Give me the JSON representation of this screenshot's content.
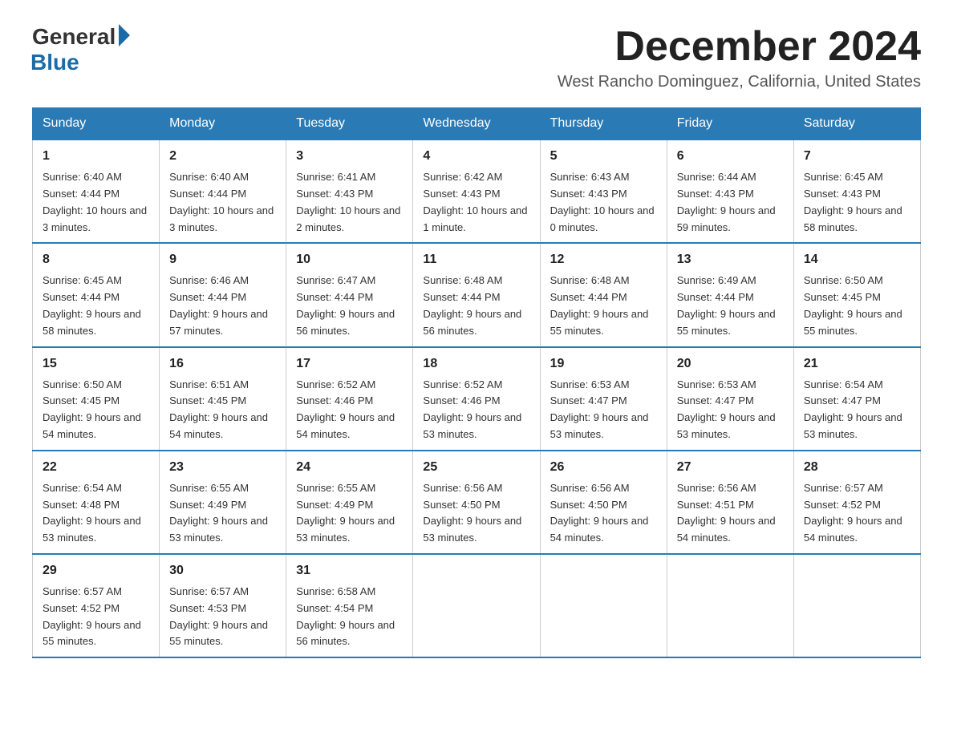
{
  "header": {
    "logo_general": "General",
    "logo_blue": "Blue",
    "month_title": "December 2024",
    "location": "West Rancho Dominguez, California, United States"
  },
  "weekdays": [
    "Sunday",
    "Monday",
    "Tuesday",
    "Wednesday",
    "Thursday",
    "Friday",
    "Saturday"
  ],
  "weeks": [
    [
      {
        "day": "1",
        "sunrise": "6:40 AM",
        "sunset": "4:44 PM",
        "daylight": "10 hours and 3 minutes."
      },
      {
        "day": "2",
        "sunrise": "6:40 AM",
        "sunset": "4:44 PM",
        "daylight": "10 hours and 3 minutes."
      },
      {
        "day": "3",
        "sunrise": "6:41 AM",
        "sunset": "4:43 PM",
        "daylight": "10 hours and 2 minutes."
      },
      {
        "day": "4",
        "sunrise": "6:42 AM",
        "sunset": "4:43 PM",
        "daylight": "10 hours and 1 minute."
      },
      {
        "day": "5",
        "sunrise": "6:43 AM",
        "sunset": "4:43 PM",
        "daylight": "10 hours and 0 minutes."
      },
      {
        "day": "6",
        "sunrise": "6:44 AM",
        "sunset": "4:43 PM",
        "daylight": "9 hours and 59 minutes."
      },
      {
        "day": "7",
        "sunrise": "6:45 AM",
        "sunset": "4:43 PM",
        "daylight": "9 hours and 58 minutes."
      }
    ],
    [
      {
        "day": "8",
        "sunrise": "6:45 AM",
        "sunset": "4:44 PM",
        "daylight": "9 hours and 58 minutes."
      },
      {
        "day": "9",
        "sunrise": "6:46 AM",
        "sunset": "4:44 PM",
        "daylight": "9 hours and 57 minutes."
      },
      {
        "day": "10",
        "sunrise": "6:47 AM",
        "sunset": "4:44 PM",
        "daylight": "9 hours and 56 minutes."
      },
      {
        "day": "11",
        "sunrise": "6:48 AM",
        "sunset": "4:44 PM",
        "daylight": "9 hours and 56 minutes."
      },
      {
        "day": "12",
        "sunrise": "6:48 AM",
        "sunset": "4:44 PM",
        "daylight": "9 hours and 55 minutes."
      },
      {
        "day": "13",
        "sunrise": "6:49 AM",
        "sunset": "4:44 PM",
        "daylight": "9 hours and 55 minutes."
      },
      {
        "day": "14",
        "sunrise": "6:50 AM",
        "sunset": "4:45 PM",
        "daylight": "9 hours and 55 minutes."
      }
    ],
    [
      {
        "day": "15",
        "sunrise": "6:50 AM",
        "sunset": "4:45 PM",
        "daylight": "9 hours and 54 minutes."
      },
      {
        "day": "16",
        "sunrise": "6:51 AM",
        "sunset": "4:45 PM",
        "daylight": "9 hours and 54 minutes."
      },
      {
        "day": "17",
        "sunrise": "6:52 AM",
        "sunset": "4:46 PM",
        "daylight": "9 hours and 54 minutes."
      },
      {
        "day": "18",
        "sunrise": "6:52 AM",
        "sunset": "4:46 PM",
        "daylight": "9 hours and 53 minutes."
      },
      {
        "day": "19",
        "sunrise": "6:53 AM",
        "sunset": "4:47 PM",
        "daylight": "9 hours and 53 minutes."
      },
      {
        "day": "20",
        "sunrise": "6:53 AM",
        "sunset": "4:47 PM",
        "daylight": "9 hours and 53 minutes."
      },
      {
        "day": "21",
        "sunrise": "6:54 AM",
        "sunset": "4:47 PM",
        "daylight": "9 hours and 53 minutes."
      }
    ],
    [
      {
        "day": "22",
        "sunrise": "6:54 AM",
        "sunset": "4:48 PM",
        "daylight": "9 hours and 53 minutes."
      },
      {
        "day": "23",
        "sunrise": "6:55 AM",
        "sunset": "4:49 PM",
        "daylight": "9 hours and 53 minutes."
      },
      {
        "day": "24",
        "sunrise": "6:55 AM",
        "sunset": "4:49 PM",
        "daylight": "9 hours and 53 minutes."
      },
      {
        "day": "25",
        "sunrise": "6:56 AM",
        "sunset": "4:50 PM",
        "daylight": "9 hours and 53 minutes."
      },
      {
        "day": "26",
        "sunrise": "6:56 AM",
        "sunset": "4:50 PM",
        "daylight": "9 hours and 54 minutes."
      },
      {
        "day": "27",
        "sunrise": "6:56 AM",
        "sunset": "4:51 PM",
        "daylight": "9 hours and 54 minutes."
      },
      {
        "day": "28",
        "sunrise": "6:57 AM",
        "sunset": "4:52 PM",
        "daylight": "9 hours and 54 minutes."
      }
    ],
    [
      {
        "day": "29",
        "sunrise": "6:57 AM",
        "sunset": "4:52 PM",
        "daylight": "9 hours and 55 minutes."
      },
      {
        "day": "30",
        "sunrise": "6:57 AM",
        "sunset": "4:53 PM",
        "daylight": "9 hours and 55 minutes."
      },
      {
        "day": "31",
        "sunrise": "6:58 AM",
        "sunset": "4:54 PM",
        "daylight": "9 hours and 56 minutes."
      },
      null,
      null,
      null,
      null
    ]
  ]
}
